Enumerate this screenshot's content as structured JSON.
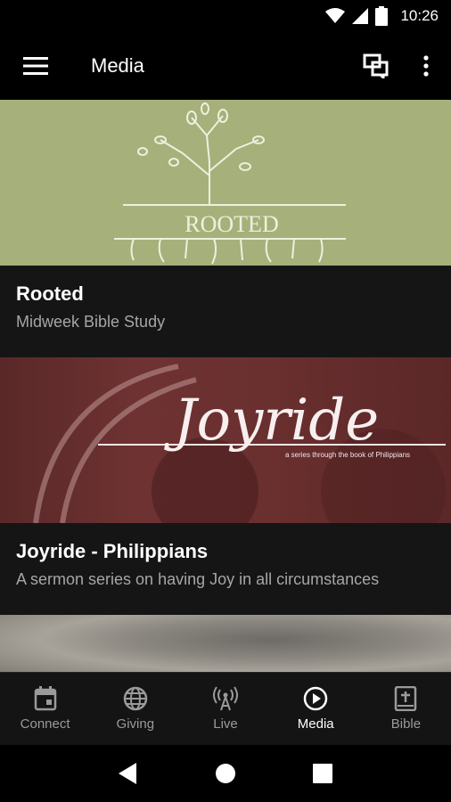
{
  "status_bar": {
    "time": "10:26",
    "icons": [
      "wifi-icon",
      "signal-icon",
      "battery-icon"
    ]
  },
  "app_bar": {
    "title": "Media",
    "icons": [
      "menu-icon",
      "chat-icon",
      "more-vert-icon"
    ]
  },
  "media_items": [
    {
      "title": "Rooted",
      "subtitle": "Midweek Bible Study",
      "image_text": "ROOTED"
    },
    {
      "title": "Joyride - Philippians",
      "subtitle": "A sermon series on having Joy in all circumstances",
      "image_text": "Joyride",
      "image_caption": "a series through the book of Philippians"
    }
  ],
  "bottom_nav": {
    "items": [
      {
        "label": "Connect",
        "icon": "calendar-icon"
      },
      {
        "label": "Giving",
        "icon": "globe-icon"
      },
      {
        "label": "Live",
        "icon": "broadcast-icon"
      },
      {
        "label": "Media",
        "icon": "play-circle-icon",
        "active": true
      },
      {
        "label": "Bible",
        "icon": "bible-icon"
      }
    ]
  },
  "colors": {
    "background": "#141414",
    "rooted_bg": "#a6b07a",
    "joyride_bg": "#6a2f2f",
    "inactive": "#9a9a9a"
  }
}
